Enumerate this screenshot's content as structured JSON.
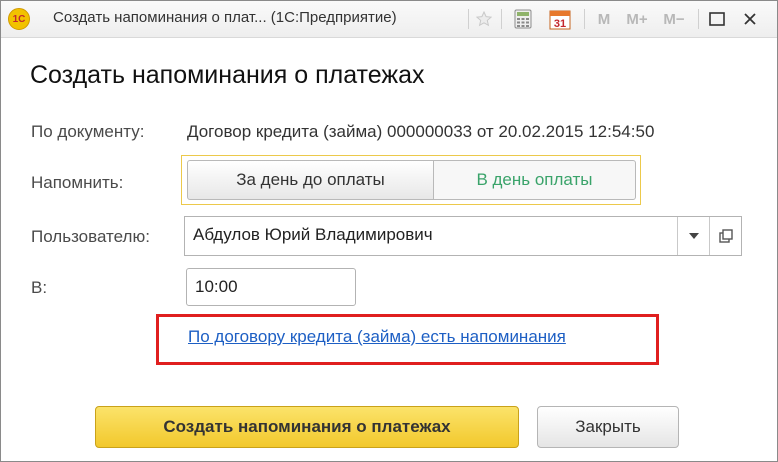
{
  "window": {
    "logo_text": "1С",
    "title": "Создать напоминания о плат...  (1С:Предприятие)",
    "toolbar": {
      "calendar_day": "31",
      "mem_m": "M",
      "mem_plus": "M+",
      "mem_minus": "M−"
    }
  },
  "form": {
    "heading": "Создать напоминания о платежах",
    "doc_label": "По документу:",
    "doc_value": "Договор кредита (займа) 000000033 от 20.02.2015 12:54:50",
    "remind_label": "Напомнить:",
    "remind_options": [
      "За день до оплаты",
      "В день оплаты"
    ],
    "user_label": "Пользователю:",
    "user_value": "Абдулов Юрий Владимирович",
    "time_label": "В:",
    "time_value": "10:00",
    "link_text": "По договору кредита (займа) есть напоминания"
  },
  "buttons": {
    "create": "Создать напоминания о платежах",
    "close": "Закрыть"
  },
  "colors": {
    "accent_yellow": "#f2c82c",
    "highlight_red": "#e01f1f",
    "link_blue": "#1d5fc4",
    "selected_option_green": "#3aa36a"
  }
}
